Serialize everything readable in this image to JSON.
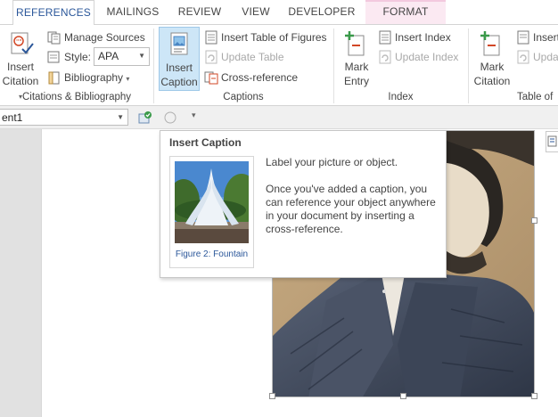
{
  "tabs": [
    {
      "label": "REFERENCES",
      "active": true
    },
    {
      "label": "MAILINGS",
      "active": false
    },
    {
      "label": "REVIEW",
      "active": false
    },
    {
      "label": "VIEW",
      "active": false
    },
    {
      "label": "DEVELOPER",
      "active": false
    },
    {
      "label": "FORMAT",
      "active": false,
      "contextual": true
    }
  ],
  "ribbon": {
    "citations": {
      "insert_citation": "Insert",
      "insert_citation_2": "Citation",
      "manage_sources": "Manage Sources",
      "style_label": "Style:",
      "style_value": "APA",
      "bibliography": "Bibliography",
      "group_label": "Citations & Bibliography"
    },
    "captions": {
      "insert_caption": "Insert",
      "insert_caption_2": "Caption",
      "insert_table_of_figures": "Insert Table of Figures",
      "update_table": "Update Table",
      "cross_reference": "Cross-reference",
      "group_label": "Captions"
    },
    "index": {
      "mark_entry": "Mark",
      "mark_entry_2": "Entry",
      "insert_index": "Insert Index",
      "update_index": "Update Index",
      "group_label": "Index"
    },
    "toa": {
      "mark_citation": "Mark",
      "mark_citation_2": "Citation",
      "insert_toa": "Insert",
      "update_toa": "Upda",
      "group_label": "Table of"
    }
  },
  "toolbar": {
    "name_box_value": "ent1"
  },
  "tooltip": {
    "title": "Insert Caption",
    "description": "Label your picture or object.",
    "detail_lines": [
      "Once you've added a caption, you",
      "can reference your object anywhere",
      "in your document by inserting a",
      "cross-reference."
    ],
    "preview_caption": "Figure 2: Fountain"
  },
  "colors": {
    "accent": "#2b579a",
    "pressed": "#cde6f7",
    "contextual_tab": "#fbe9f2"
  }
}
